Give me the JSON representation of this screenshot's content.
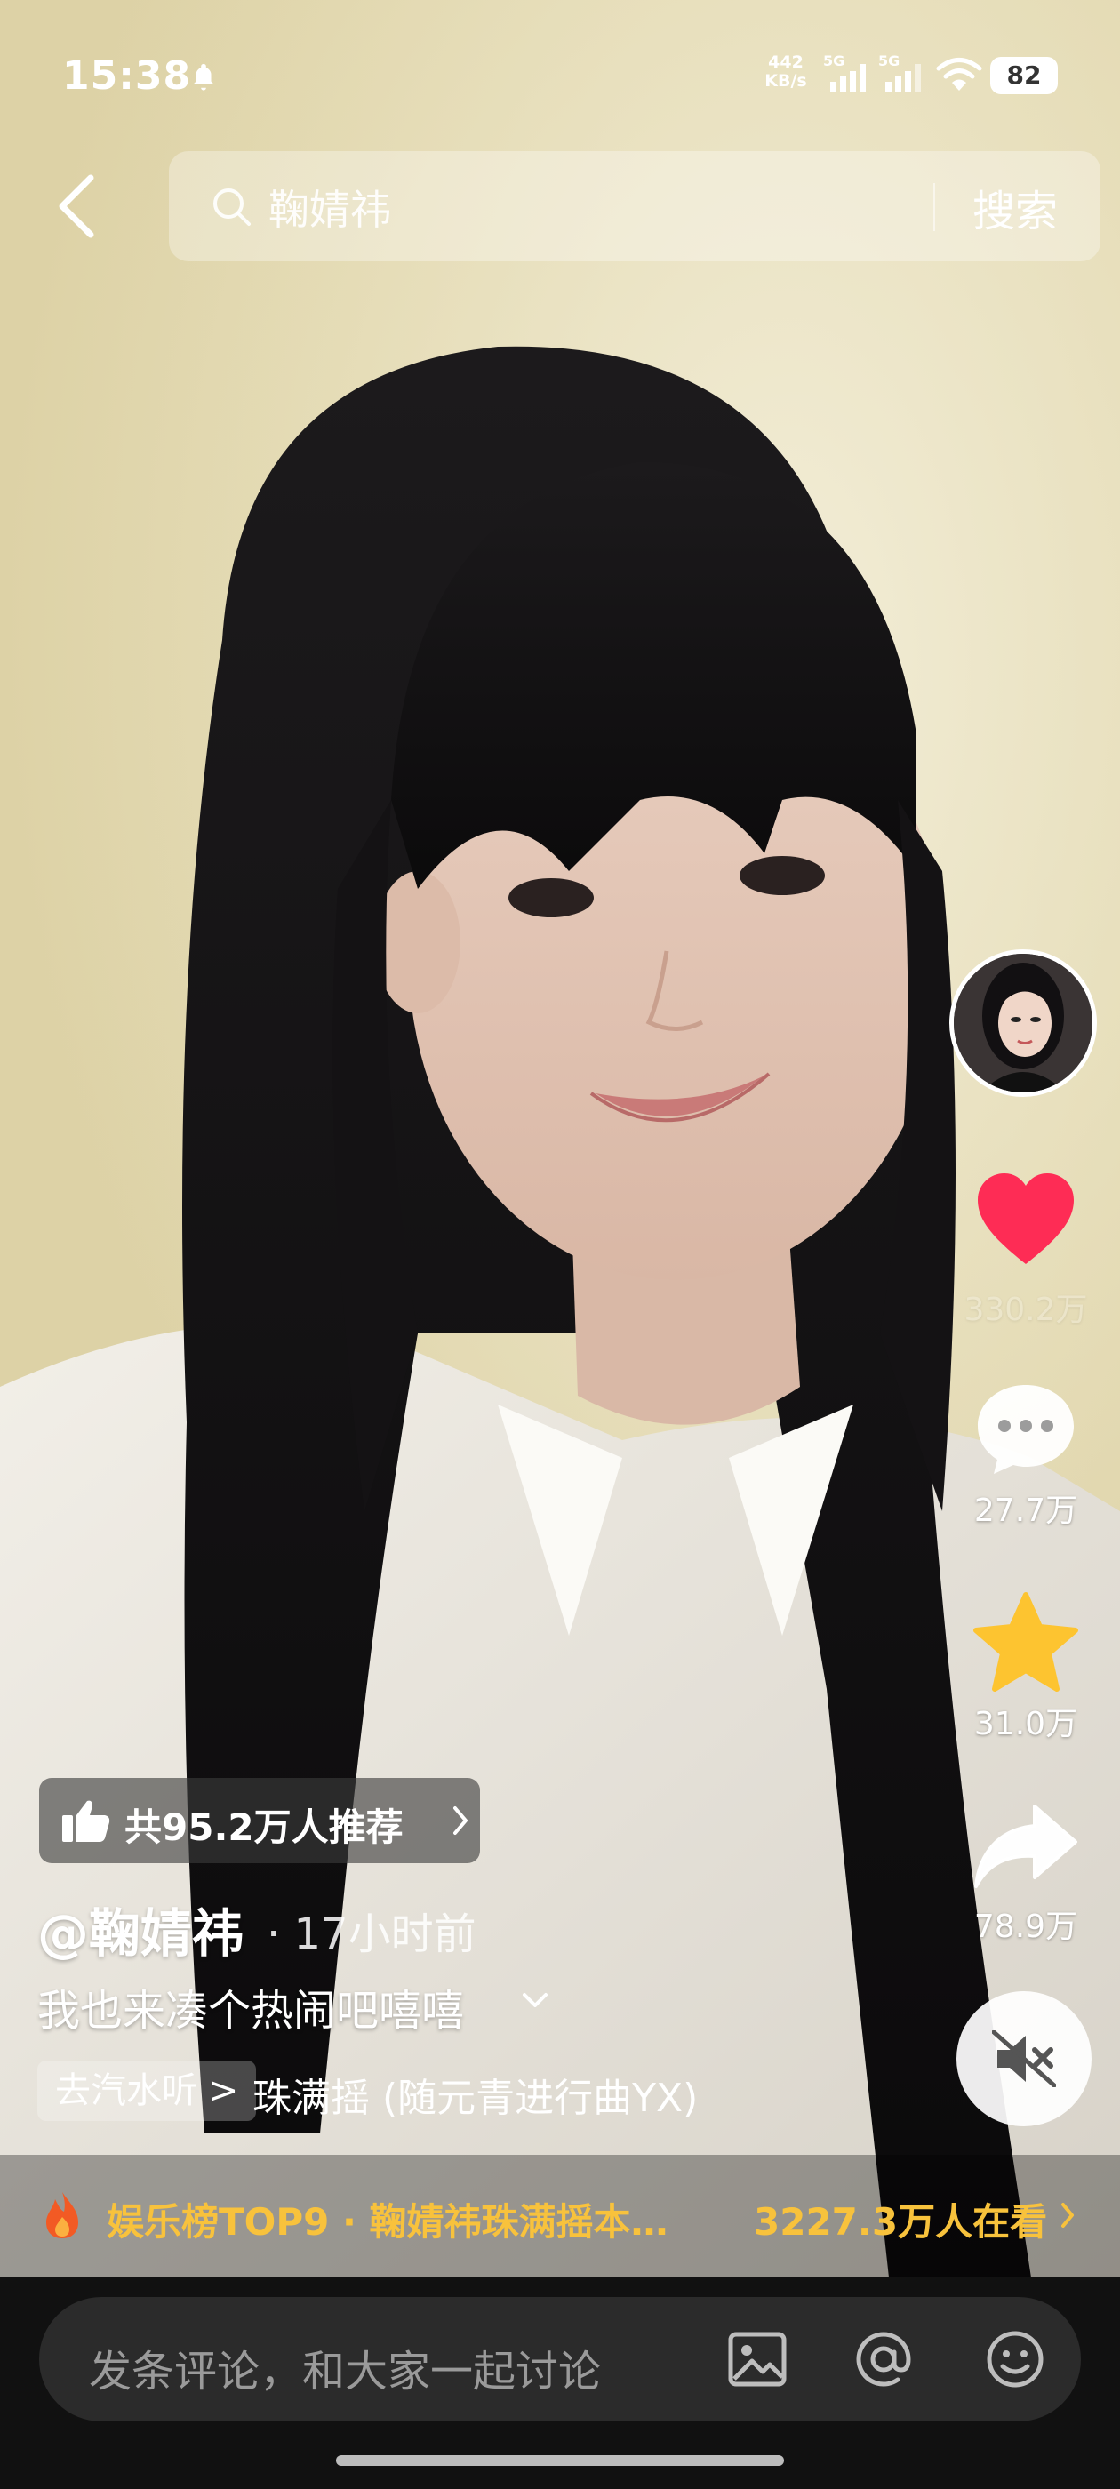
{
  "status_bar": {
    "time": "15:38",
    "net_speed_value": "442",
    "net_speed_unit": "KB/s",
    "sim1": "5G",
    "sim2": "5G",
    "battery": "82"
  },
  "search": {
    "query": "鞠婧祎",
    "button": "搜索"
  },
  "actions": {
    "likes": "330.2万",
    "comments": "27.7万",
    "favorites": "31.0万",
    "shares": "78.9万"
  },
  "video_info": {
    "recommend": "共95.2万人推荐",
    "author": "@鞠婧祎",
    "time_ago": "· 17小时前",
    "description": "我也来凑个热闹吧嘻嘻",
    "music_tag": "去汽水听 >",
    "music_name": "珠满摇 (随元青进行曲YX)"
  },
  "hot_banner": {
    "text": "娱乐榜TOP9 · 鞠婧祎珠满摇本…",
    "watching": "3227.3万人在看"
  },
  "comment_bar": {
    "placeholder": "发条评论，和大家一起讨论"
  },
  "colors": {
    "like": "#fe2c55",
    "favorite": "#fdc430",
    "hot": "#f8c23c"
  }
}
